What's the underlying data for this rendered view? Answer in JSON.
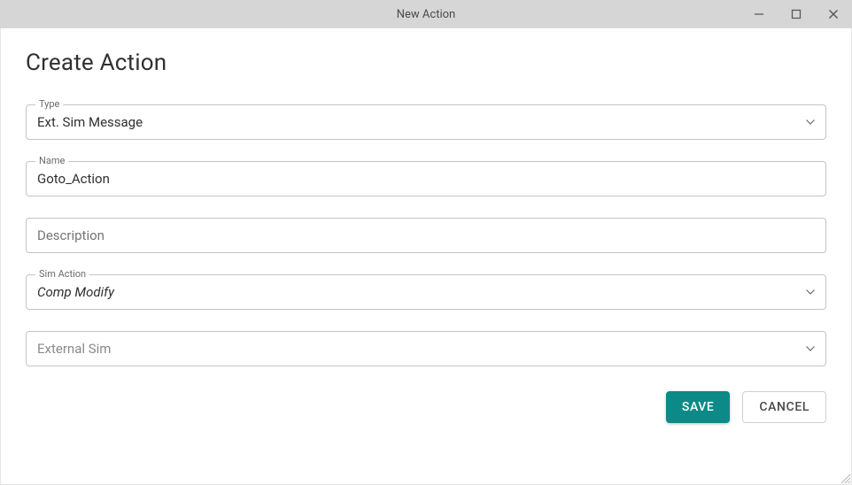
{
  "window": {
    "title": "New Action"
  },
  "page": {
    "heading": "Create Action"
  },
  "fields": {
    "type": {
      "label": "Type",
      "value": "Ext. Sim Message"
    },
    "name": {
      "label": "Name",
      "value": "Goto_Action"
    },
    "description": {
      "placeholder": "Description",
      "value": ""
    },
    "simAction": {
      "label": "Sim Action",
      "value": "Comp Modify"
    },
    "externalSim": {
      "placeholder": "External Sim",
      "value": ""
    }
  },
  "buttons": {
    "save": "SAVE",
    "cancel": "CANCEL"
  }
}
